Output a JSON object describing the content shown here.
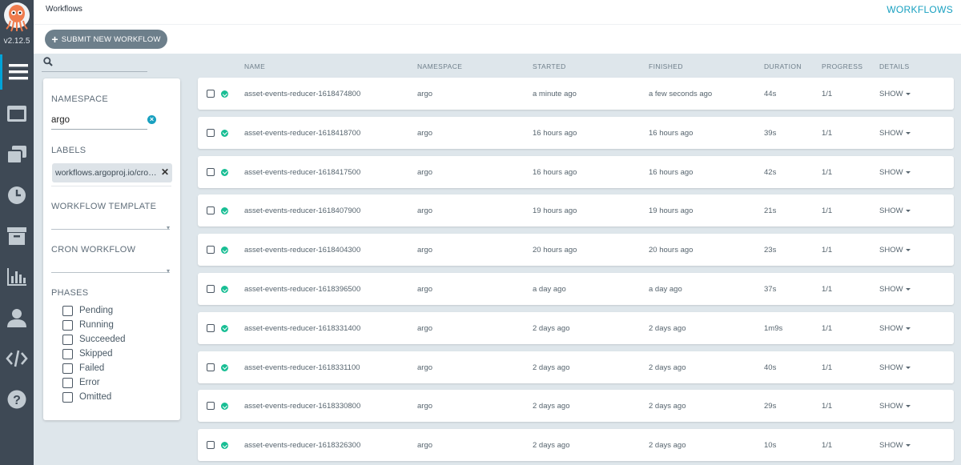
{
  "app": {
    "version": "v2.12.5",
    "breadcrumb": "Workflows",
    "page_title": "WORKFLOWS",
    "submit_label": "SUBMIT NEW WORKFLOW",
    "accent_color": "#18a0c0",
    "success_color": "#18be94"
  },
  "nav": {
    "items": [
      {
        "icon": "workflows-list-icon",
        "active": true
      },
      {
        "icon": "workflow-templates-icon",
        "active": false
      },
      {
        "icon": "cluster-workflow-templates-icon",
        "active": false
      },
      {
        "icon": "cron-workflows-icon",
        "active": false
      },
      {
        "icon": "archived-workflows-icon",
        "active": false
      },
      {
        "icon": "reports-icon",
        "active": false
      },
      {
        "icon": "user-icon",
        "active": false
      },
      {
        "icon": "api-docs-icon",
        "active": false
      },
      {
        "icon": "help-icon",
        "active": false
      }
    ]
  },
  "filters": {
    "namespace_title": "NAMESPACE",
    "namespace_value": "argo",
    "labels_title": "LABELS",
    "label_chip": "workflows.argoproj.io/cro…",
    "workflow_template_title": "WORKFLOW TEMPLATE",
    "cron_workflow_title": "CRON WORKFLOW",
    "phases_title": "PHASES",
    "phases": [
      "Pending",
      "Running",
      "Succeeded",
      "Skipped",
      "Failed",
      "Error",
      "Omitted"
    ]
  },
  "table": {
    "headers": {
      "name": "NAME",
      "namespace": "NAMESPACE",
      "started": "STARTED",
      "finished": "FINISHED",
      "duration": "DURATION",
      "progress": "PROGRESS",
      "details": "DETAILS"
    },
    "rows": [
      {
        "name": "asset-events-reducer-1618474800",
        "namespace": "argo",
        "started": "a minute ago",
        "finished": "a few seconds ago",
        "duration": "44s",
        "progress": "1/1",
        "details": "SHOW"
      },
      {
        "name": "asset-events-reducer-1618418700",
        "namespace": "argo",
        "started": "16 hours ago",
        "finished": "16 hours ago",
        "duration": "39s",
        "progress": "1/1",
        "details": "SHOW"
      },
      {
        "name": "asset-events-reducer-1618417500",
        "namespace": "argo",
        "started": "16 hours ago",
        "finished": "16 hours ago",
        "duration": "42s",
        "progress": "1/1",
        "details": "SHOW"
      },
      {
        "name": "asset-events-reducer-1618407900",
        "namespace": "argo",
        "started": "19 hours ago",
        "finished": "19 hours ago",
        "duration": "21s",
        "progress": "1/1",
        "details": "SHOW"
      },
      {
        "name": "asset-events-reducer-1618404300",
        "namespace": "argo",
        "started": "20 hours ago",
        "finished": "20 hours ago",
        "duration": "23s",
        "progress": "1/1",
        "details": "SHOW"
      },
      {
        "name": "asset-events-reducer-1618396500",
        "namespace": "argo",
        "started": "a day ago",
        "finished": "a day ago",
        "duration": "37s",
        "progress": "1/1",
        "details": "SHOW"
      },
      {
        "name": "asset-events-reducer-1618331400",
        "namespace": "argo",
        "started": "2 days ago",
        "finished": "2 days ago",
        "duration": "1m9s",
        "progress": "1/1",
        "details": "SHOW"
      },
      {
        "name": "asset-events-reducer-1618331100",
        "namespace": "argo",
        "started": "2 days ago",
        "finished": "2 days ago",
        "duration": "40s",
        "progress": "1/1",
        "details": "SHOW"
      },
      {
        "name": "asset-events-reducer-1618330800",
        "namespace": "argo",
        "started": "2 days ago",
        "finished": "2 days ago",
        "duration": "29s",
        "progress": "1/1",
        "details": "SHOW"
      },
      {
        "name": "asset-events-reducer-1618326300",
        "namespace": "argo",
        "started": "2 days ago",
        "finished": "2 days ago",
        "duration": "10s",
        "progress": "1/1",
        "details": "SHOW"
      }
    ]
  }
}
